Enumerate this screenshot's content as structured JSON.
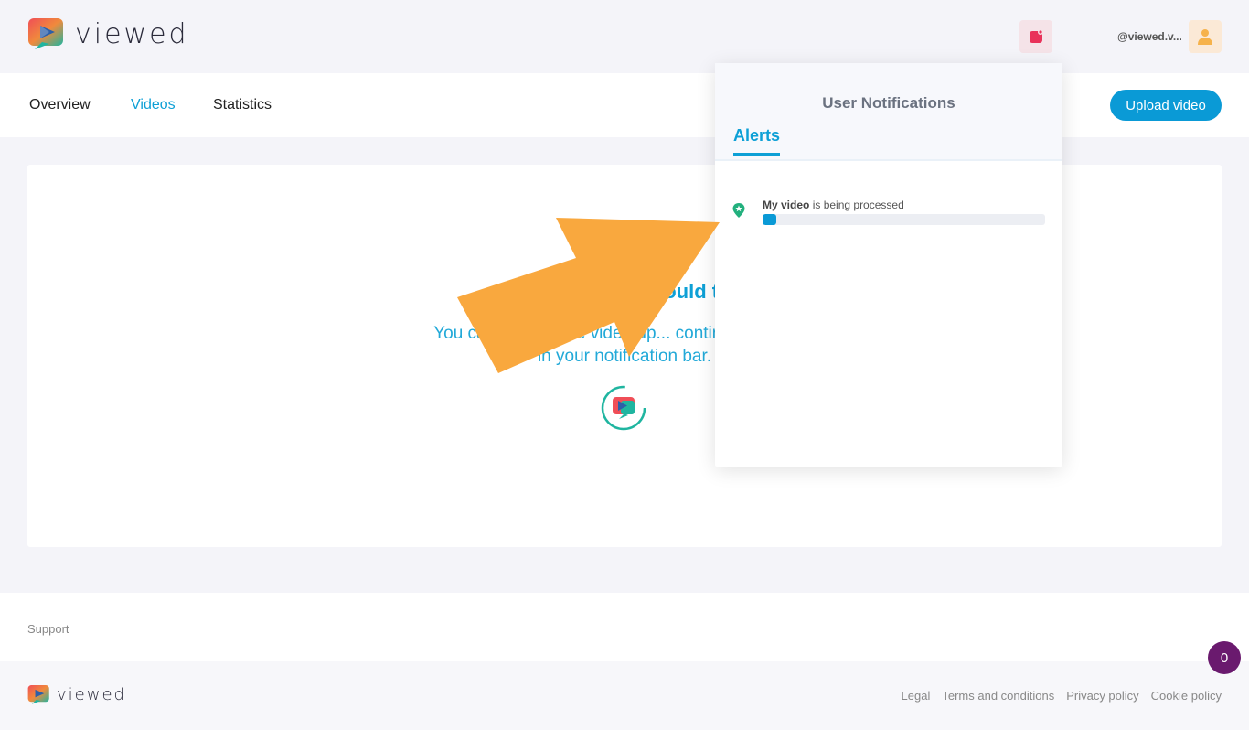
{
  "header": {
    "logo_text": "viewed",
    "username": "@viewed.v..."
  },
  "nav": {
    "items": [
      {
        "label": "Overview"
      },
      {
        "label": "Videos"
      },
      {
        "label": "Statistics"
      }
    ],
    "upload_label": "Upload video"
  },
  "main": {
    "title": "We are mak... ould t",
    "subtitle_line1": "You can wait for the video up... contin... browsing.",
    "subtitle_line2": "in your notification bar."
  },
  "notifications": {
    "title": "User Notifications",
    "tab": "Alerts",
    "items": [
      {
        "subject": "My video",
        "message": " is being processed",
        "progress": 0.05
      }
    ]
  },
  "footer": {
    "support": "Support",
    "logo_text": "viewed",
    "links": [
      "Legal",
      "Terms and conditions",
      "Privacy policy",
      "Cookie policy"
    ]
  },
  "chat": {
    "count": "0"
  },
  "colors": {
    "accent": "#0ea0d6",
    "upload": "#0a9ad6",
    "arrow": "#f9a83e",
    "chat": "#6a1a6e",
    "notif_icon": "#22b07d"
  }
}
